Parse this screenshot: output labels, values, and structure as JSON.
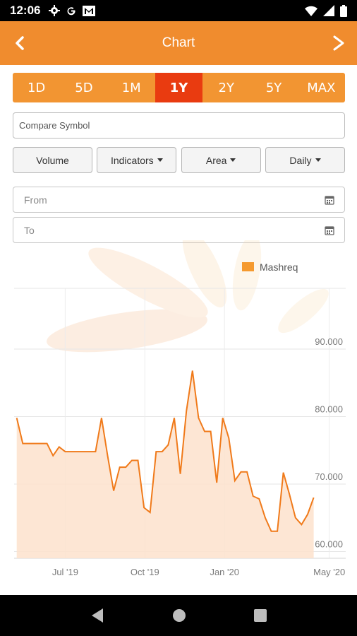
{
  "status": {
    "time": "12:06"
  },
  "header": {
    "title": "Chart"
  },
  "ranges": [
    "1D",
    "5D",
    "1M",
    "1Y",
    "2Y",
    "5Y",
    "MAX"
  ],
  "active_range": "1Y",
  "compare": {
    "placeholder": "Compare Symbol"
  },
  "options": {
    "volume": "Volume",
    "indicators": "Indicators",
    "chart_type": "Area",
    "interval": "Daily"
  },
  "from_placeholder": "From",
  "to_placeholder": "To",
  "colors": {
    "accent": "#f08c2e",
    "active_tab": "#e93b10",
    "series_line": "#f07a1a",
    "series_fill": "#fde2cc"
  },
  "chart_data": {
    "type": "area",
    "legend": [
      "Mashreq"
    ],
    "legend_position": "top-right",
    "grid": true,
    "ylim": [
      59,
      99
    ],
    "y_ticks": [
      "60.000",
      "70.000",
      "80.000",
      "90.000"
    ],
    "y_tick_values": [
      60,
      70,
      80,
      90
    ],
    "x_tick_labels": [
      "Jul '19",
      "Oct '19",
      "Jan '20",
      "May '20"
    ],
    "x_tick_dates": [
      "2019-07-01",
      "2019-10-01",
      "2020-01-01",
      "2020-05-01"
    ],
    "series": [
      {
        "name": "Mashreq",
        "points": [
          [
            "2019-05-06",
            79.8
          ],
          [
            "2019-05-13",
            76.0
          ],
          [
            "2019-05-20",
            76.0
          ],
          [
            "2019-05-27",
            76.0
          ],
          [
            "2019-06-03",
            76.0
          ],
          [
            "2019-06-10",
            76.0
          ],
          [
            "2019-06-17",
            74.2
          ],
          [
            "2019-06-24",
            75.5
          ],
          [
            "2019-07-01",
            74.8
          ],
          [
            "2019-07-08",
            74.8
          ],
          [
            "2019-07-15",
            74.8
          ],
          [
            "2019-07-22",
            74.8
          ],
          [
            "2019-07-29",
            74.8
          ],
          [
            "2019-08-05",
            74.8
          ],
          [
            "2019-08-12",
            79.8
          ],
          [
            "2019-08-19",
            74.2
          ],
          [
            "2019-08-26",
            69.0
          ],
          [
            "2019-09-02",
            72.5
          ],
          [
            "2019-09-09",
            72.5
          ],
          [
            "2019-09-16",
            73.5
          ],
          [
            "2019-09-23",
            73.5
          ],
          [
            "2019-09-30",
            66.5
          ],
          [
            "2019-10-07",
            65.8
          ],
          [
            "2019-10-14",
            74.8
          ],
          [
            "2019-10-21",
            74.8
          ],
          [
            "2019-10-28",
            75.8
          ],
          [
            "2019-11-04",
            79.8
          ],
          [
            "2019-11-11",
            71.5
          ],
          [
            "2019-11-18",
            80.8
          ],
          [
            "2019-11-25",
            86.8
          ],
          [
            "2019-12-02",
            79.8
          ],
          [
            "2019-12-09",
            77.8
          ],
          [
            "2019-12-16",
            77.8
          ],
          [
            "2019-12-23",
            70.2
          ],
          [
            "2019-12-30",
            79.8
          ],
          [
            "2020-01-06",
            76.8
          ],
          [
            "2020-01-13",
            70.5
          ],
          [
            "2020-01-20",
            71.8
          ],
          [
            "2020-01-27",
            71.8
          ],
          [
            "2020-02-03",
            68.2
          ],
          [
            "2020-02-10",
            67.8
          ],
          [
            "2020-02-17",
            65.0
          ],
          [
            "2020-02-24",
            63.0
          ],
          [
            "2020-03-02",
            63.0
          ],
          [
            "2020-03-09",
            71.7
          ],
          [
            "2020-03-16",
            68.5
          ],
          [
            "2020-03-23",
            65.0
          ],
          [
            "2020-03-30",
            64.0
          ],
          [
            "2020-04-06",
            65.5
          ],
          [
            "2020-04-13",
            68.0
          ]
        ]
      }
    ]
  }
}
